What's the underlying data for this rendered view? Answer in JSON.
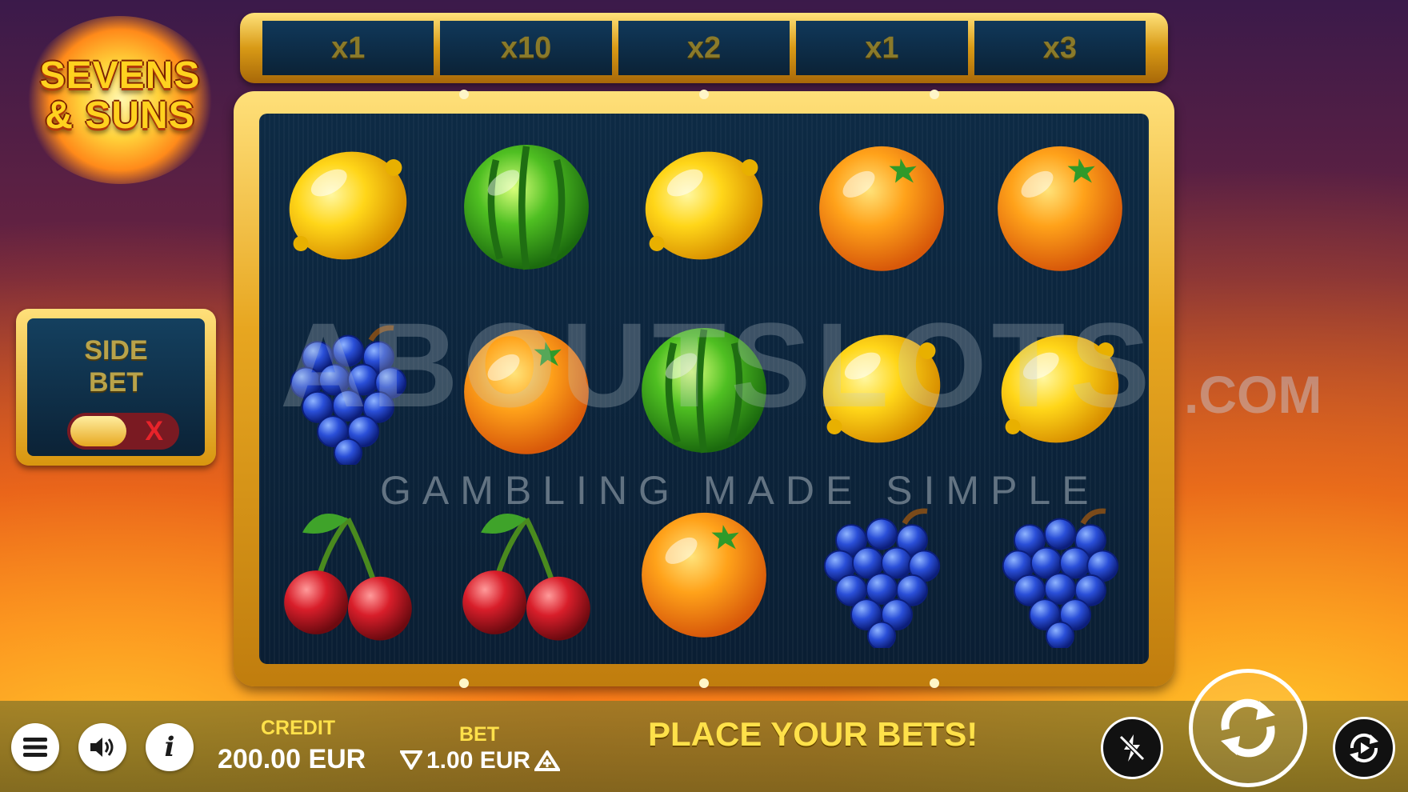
{
  "game": {
    "logo_line1": "SEVENS",
    "logo_line2": "& SUNS"
  },
  "multipliers": [
    "x1",
    "x10",
    "x2",
    "x1",
    "x3"
  ],
  "reels": [
    [
      "lemon",
      "watermelon",
      "lemon",
      "orange",
      "orange"
    ],
    [
      "grapes",
      "orange",
      "watermelon",
      "lemon",
      "lemon"
    ],
    [
      "cherries",
      "cherries",
      "orange",
      "grapes",
      "grapes"
    ]
  ],
  "side_bet": {
    "title_line1": "SIDE",
    "title_line2": "BET",
    "toggle_off_symbol": "X",
    "enabled": false
  },
  "watermark": {
    "brand": "ABOUTSLOTS",
    "tld": ".COM",
    "tagline": "GAMBLING MADE SIMPLE"
  },
  "bottom_bar": {
    "credit_label": "CREDIT",
    "credit_value": "200.00 EUR",
    "bet_label": "BET",
    "bet_value": "1.00 EUR",
    "message": "PLACE YOUR BETS!",
    "icons": {
      "menu": "menu-icon",
      "sound": "sound-icon",
      "info": "info-icon",
      "turbo": "turbo-off-icon",
      "spin": "spin-icon",
      "autoplay": "autoplay-icon"
    }
  },
  "colors": {
    "accent_yellow": "#ffe14a",
    "frame_gold": "#e7a620",
    "reel_bg": "#0d2a44"
  }
}
